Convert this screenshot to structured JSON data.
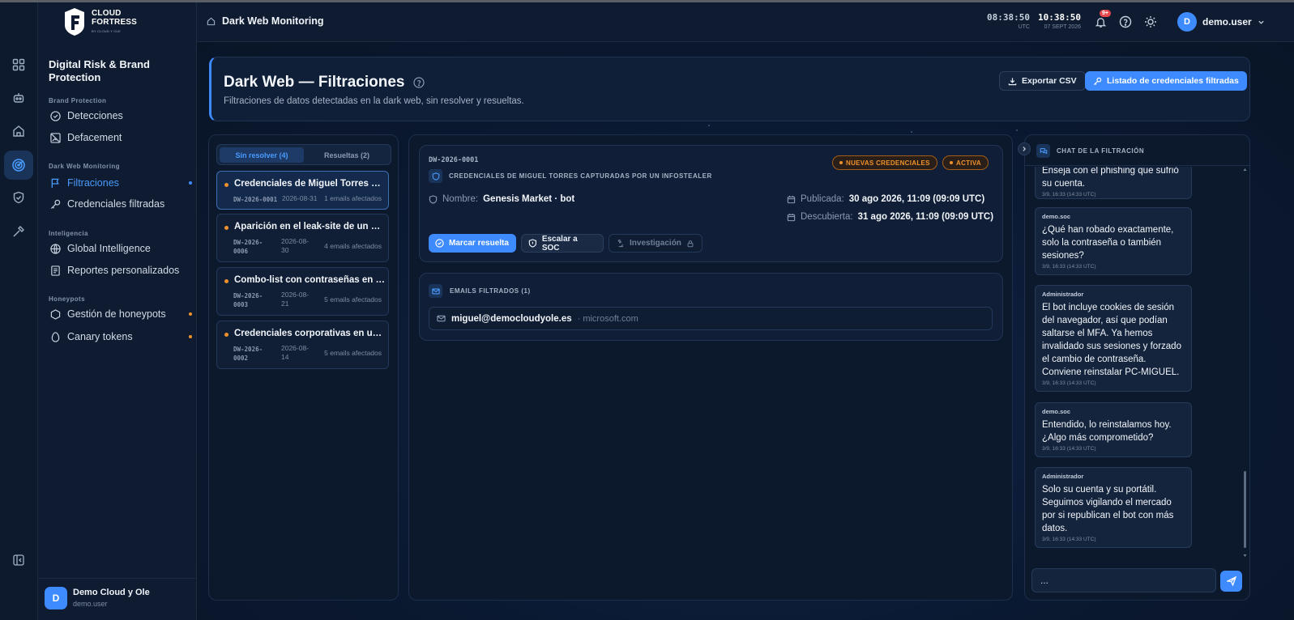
{
  "app": {
    "brand_line1": "CLOUD",
    "brand_line2": "FORTRESS",
    "brand_tagline": "BY CLOUD Y OLE"
  },
  "header": {
    "breadcrumb": "Dark Web Monitoring",
    "utc_time": "08:38:50",
    "utc_label": "UTC",
    "local_time": "10:38:50",
    "local_date": "07 SEPT 2026",
    "notif_badge": "9+",
    "username": "demo.user",
    "avatar_initial": "D"
  },
  "sidebar": {
    "title": "Digital Risk & Brand Protection",
    "sections": {
      "brand": "Brand Protection",
      "darkweb": "Dark Web Monitoring",
      "intel": "Inteligencia",
      "honeypots": "Honeypots"
    },
    "items": {
      "detecciones": "Detecciones",
      "defacement": "Defacement",
      "filtraciones": "Filtraciones",
      "credenciales": "Credenciales filtradas",
      "global_intel": "Global Intelligence",
      "reportes": "Reportes personalizados",
      "gestion_honeypots": "Gestión de honeypots",
      "canary": "Canary tokens"
    },
    "footer": {
      "avatar_initial": "D",
      "org": "Demo Cloud y Ole",
      "user": "demo.user"
    }
  },
  "page": {
    "title": "Dark Web — Filtraciones",
    "subtitle": "Filtraciones de datos detectadas en la dark web, sin resolver y resueltas.",
    "export_btn": "Exportar CSV",
    "list_btn": "Listado de credenciales filtradas"
  },
  "list": {
    "tab_unresolved": "Sin resolver (4)",
    "tab_resolved": "Resueltas (2)",
    "items": [
      {
        "title": "Credenciales de Miguel Torres capturadas por un infostealer",
        "id": "DW-2026-0001",
        "date": "2026-08-31",
        "emails": "1 emails afectados"
      },
      {
        "title": "Aparición en el leak-site de un grupo de ransomware",
        "id_a": "DW-2026-",
        "id_b": "0006",
        "date_a": "2026-08-",
        "date_b": "30",
        "emails": "4 emails afectados"
      },
      {
        "title": "Combo-list con contraseñas en foro",
        "id_a": "DW-2026-",
        "id_b": "0003",
        "date_a": "2026-08-",
        "date_b": "21",
        "emails": "5 emails afectados"
      },
      {
        "title": "Credenciales corporativas en un mercado",
        "id_a": "DW-2026-",
        "id_b": "0002",
        "date_a": "2026-08-",
        "date_b": "14",
        "emails": "5 emails afectados"
      }
    ]
  },
  "detail": {
    "id": "DW-2026-0001",
    "heading": "CREDENCIALES DE MIGUEL TORRES CAPTURADAS POR UN INFOSTEALER",
    "pill_new": "NUEVAS CREDENCIALES",
    "pill_active": "ACTIVA",
    "name_label": "Nombre:",
    "name_value": "Genesis Market · bot",
    "published_label": "Publicada:",
    "published_value": "30 ago 2026, 11:09 (09:09 UTC)",
    "discovered_label": "Descubierta:",
    "discovered_value": "31 ago 2026, 11:09 (09:09 UTC)",
    "btn_resolve": "Marcar resuelta",
    "btn_soc": "Escalar a SOC",
    "btn_invest": "Investigación",
    "emails_heading": "EMAILS FILTRADOS (1)",
    "email": "miguel@democloudyole.es",
    "email_source": "· microsoft.com"
  },
  "chat": {
    "title": "CHAT DE LA FILTRACIÓN",
    "partial_text": "Enseja con el phishing que sufrió su cuenta.",
    "partial_ts": "3/9, 16:33 (14:33 UTC)",
    "messages": [
      {
        "author": "demo.soc",
        "text": "¿Qué han robado exactamente, solo la contraseña o también sesiones?",
        "ts": "3/9, 16:33 (14:33 UTC)"
      },
      {
        "author": "Administrador",
        "text": "El bot incluye cookies de sesión del navegador, así que podían saltarse el MFA. Ya hemos invalidado sus sesiones y forzado el cambio de contraseña. Conviene reinstalar PC-MIGUEL.",
        "ts": "3/9, 16:33 (14:33 UTC)"
      },
      {
        "author": "demo.soc",
        "text": "Entendido, lo reinstalamos hoy. ¿Algo más comprometido?",
        "ts": "3/9, 16:33 (14:33 UTC)"
      },
      {
        "author": "Administrador",
        "text": "Solo su cuenta y su portátil. Seguimos vigilando el mercado por si republican el bot con más datos.",
        "ts": "3/9, 16:33 (14:33 UTC)"
      }
    ],
    "input_value": "..."
  },
  "colors": {
    "accent": "#3d8bff",
    "warning": "#f0922b",
    "bg": "#0b1628"
  }
}
